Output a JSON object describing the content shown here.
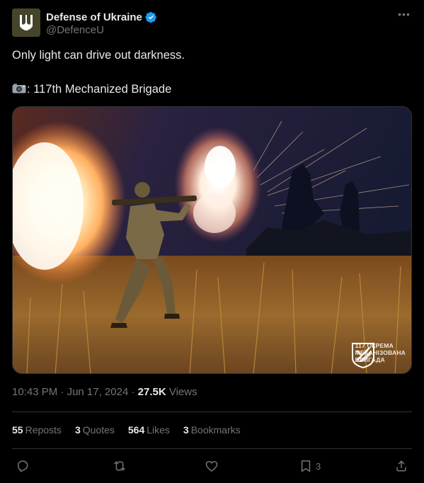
{
  "author": {
    "display_name": "Defense of Ukraine",
    "handle": "@DefenceU"
  },
  "tweet": {
    "text_line1": "Only light can drive out darkness.",
    "text_line2": ": 117th Mechanized Brigade"
  },
  "photo": {
    "watermark_line1": "117 ОКРЕМА",
    "watermark_line2": "МЕХАНІЗОВАНА",
    "watermark_line3": "БРИГАДА"
  },
  "meta": {
    "time": "10:43 PM",
    "date": "Jun 17, 2024",
    "views_count": "27.5K",
    "views_label": "Views"
  },
  "stats": {
    "reposts_count": "55",
    "reposts_label": "Reposts",
    "quotes_count": "3",
    "quotes_label": "Quotes",
    "likes_count": "564",
    "likes_label": "Likes",
    "bookmarks_count": "3",
    "bookmarks_label": "Bookmarks"
  },
  "actions": {
    "bookmark_count": "3"
  },
  "colors": {
    "background": "#000000",
    "text_primary": "#e7e9ea",
    "text_secondary": "#71767b",
    "verified": "#1d9bf0",
    "divider": "#2f3336"
  }
}
